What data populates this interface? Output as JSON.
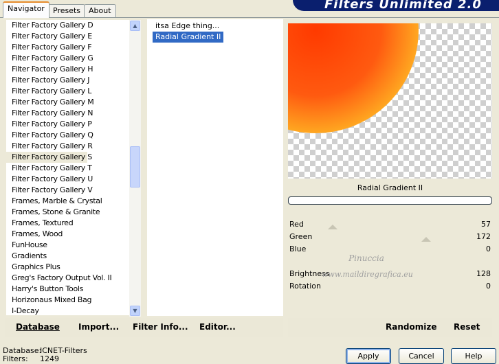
{
  "tabs": [
    {
      "label": "Navigator"
    },
    {
      "label": "Presets"
    },
    {
      "label": "About"
    }
  ],
  "banner": {
    "title": "Filters Unlimited 2.0"
  },
  "categories": [
    "Filter Factory Gallery D",
    "Filter Factory Gallery E",
    "Filter Factory Gallery F",
    "Filter Factory Gallery G",
    "Filter Factory Gallery H",
    "Filter Factory Gallery J",
    "Filter Factory Gallery L",
    "Filter Factory Gallery M",
    "Filter Factory Gallery N",
    "Filter Factory Gallery P",
    "Filter Factory Gallery Q",
    "Filter Factory Gallery R",
    "Filter Factory Gallery S",
    "Filter Factory Gallery T",
    "Filter Factory Gallery U",
    "Filter Factory Gallery V",
    "Frames, Marble & Crystal",
    "Frames, Stone & Granite",
    "Frames, Textured",
    "Frames, Wood",
    "FunHouse",
    "Gradients",
    "Graphics Plus",
    "Greg's Factory Output Vol. II",
    "Harry's Button Tools",
    "Horizonaus Mixed Bag",
    "I-Decay"
  ],
  "selected_category": "Filter Factory Gallery S",
  "filters": [
    "itsa Edge thing...",
    "Radial Gradient II"
  ],
  "selected_filter": "Radial Gradient II",
  "preview": {
    "filter_name": "Radial Gradient II"
  },
  "params": [
    {
      "label": "Red",
      "value": "57"
    },
    {
      "label": "Green",
      "value": "172"
    },
    {
      "label": "Blue",
      "value": "0"
    },
    {
      "label": "Brightness",
      "value": "128"
    },
    {
      "label": "Rotation",
      "value": "0"
    }
  ],
  "watermark": {
    "line1": "Pinuccia",
    "line2": "www.maildiregrafica.eu"
  },
  "left_buttons": {
    "database": "Database",
    "import": "Import...",
    "filter_info": "Filter Info...",
    "editor": "Editor..."
  },
  "right_buttons": {
    "randomize": "Randomize",
    "reset": "Reset"
  },
  "status": {
    "database_label": "Database:",
    "database_value": "ICNET-Filters",
    "filters_label": "Filters:",
    "filters_value": "1249"
  },
  "dialog_buttons": {
    "apply": "Apply",
    "cancel": "Cancel",
    "help": "Help"
  },
  "colors": {
    "selection": "#316ac5",
    "window": "#ece9d8",
    "banner": "#0a1f6e"
  }
}
